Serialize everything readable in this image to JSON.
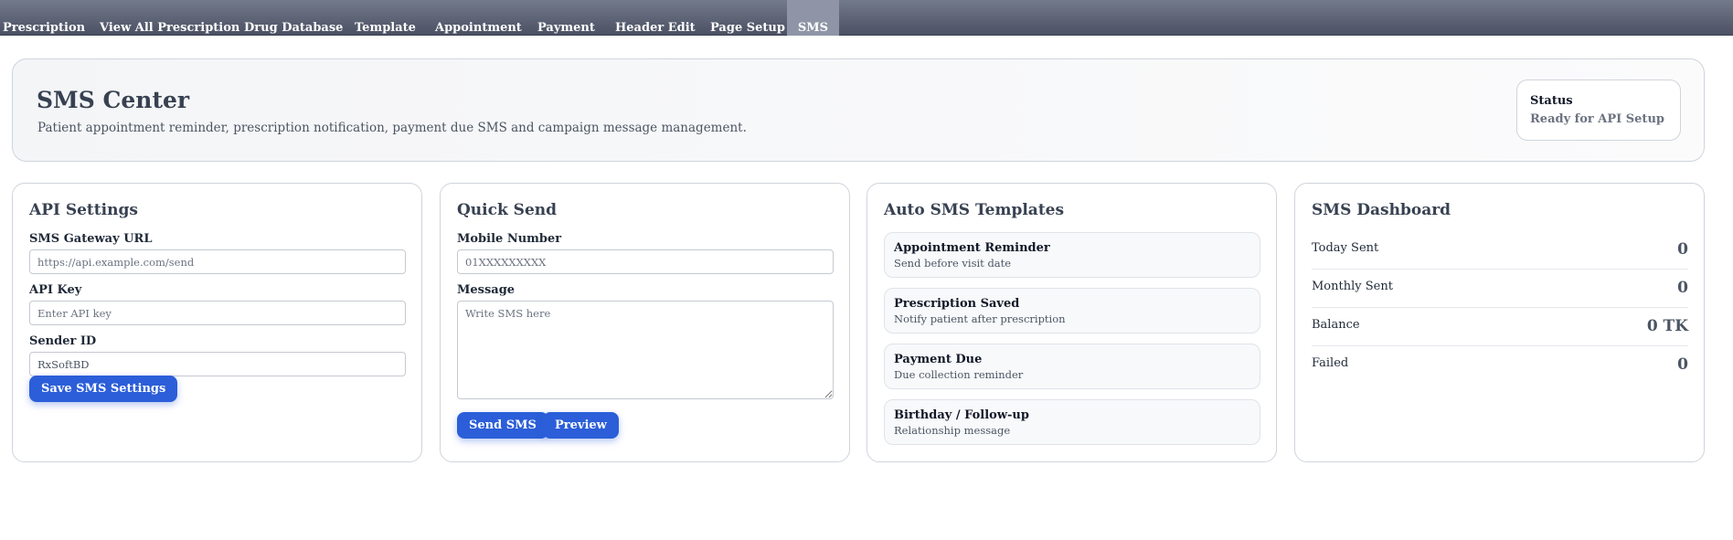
{
  "nav": {
    "items": [
      {
        "label": "Prescription"
      },
      {
        "label": "View All Prescription"
      },
      {
        "label": "Drug Database"
      },
      {
        "label": "Template"
      },
      {
        "label": "Appointment"
      },
      {
        "label": "Payment"
      },
      {
        "label": "Header Edit"
      },
      {
        "label": "Page Setup"
      },
      {
        "label": "SMS",
        "active": true
      }
    ]
  },
  "header": {
    "title": "SMS Center",
    "subtitle": "Patient appointment reminder, prescription notification, payment due SMS and campaign message management.",
    "status_label": "Status",
    "status_value": "Ready for API Setup"
  },
  "api_settings": {
    "title": "API Settings",
    "gateway_label": "SMS Gateway URL",
    "gateway_placeholder": "https://api.example.com/send",
    "api_key_label": "API Key",
    "api_key_placeholder": "Enter API key",
    "sender_label": "Sender ID",
    "sender_value": "RxSoftBD",
    "save_label": "Save SMS Settings"
  },
  "quick_send": {
    "title": "Quick Send",
    "mobile_label": "Mobile Number",
    "mobile_placeholder": "01XXXXXXXXX",
    "message_label": "Message",
    "message_placeholder": "Write SMS here",
    "send_label": "Send SMS",
    "preview_label": "Preview"
  },
  "templates": {
    "title": "Auto SMS Templates",
    "items": [
      {
        "title": "Appointment Reminder",
        "desc": "Send before visit date"
      },
      {
        "title": "Prescription Saved",
        "desc": "Notify patient after prescription"
      },
      {
        "title": "Payment Due",
        "desc": "Due collection reminder"
      },
      {
        "title": "Birthday / Follow-up",
        "desc": "Relationship message"
      }
    ]
  },
  "dashboard": {
    "title": "SMS Dashboard",
    "stats": [
      {
        "label": "Today Sent",
        "value": "0"
      },
      {
        "label": "Monthly Sent",
        "value": "0"
      },
      {
        "label": "Balance",
        "value": "0 TK"
      },
      {
        "label": "Failed",
        "value": "0"
      }
    ]
  },
  "colors": {
    "accent": "#2b5ed8",
    "nav_bg": "#5d6375"
  }
}
